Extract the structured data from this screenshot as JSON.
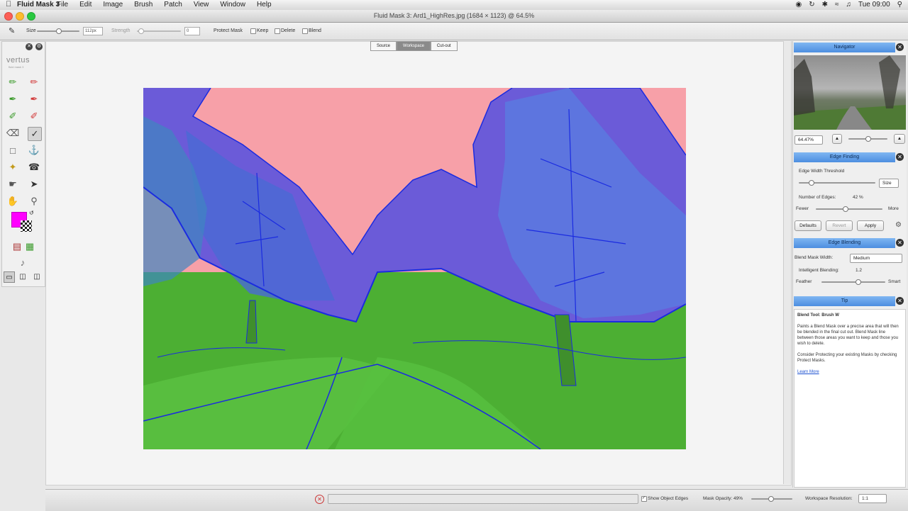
{
  "menubar": {
    "app_name": "Fluid Mask 3",
    "menus": [
      "File",
      "Edit",
      "Image",
      "Brush",
      "Patch",
      "View",
      "Window",
      "Help"
    ],
    "time": "Tue 09:00"
  },
  "window": {
    "title": "Fluid Mask 3: Ard1_HighRes.jpg (1684 × 1123) @ 64.5%"
  },
  "options": {
    "size_label": "Size",
    "size_value": "112px",
    "strength_label": "Strength",
    "strength_value": "0",
    "protect_mask_label": "Protect Mask",
    "keep_label": "Keep",
    "delete_label": "Delete",
    "blend_label": "Blend"
  },
  "leftbar": {
    "logo": "vertus",
    "logo_sub": "fluid mask 3"
  },
  "tabs": [
    "Source",
    "Workspace",
    "Cut-out"
  ],
  "active_tab": "Workspace",
  "navigator": {
    "title": "Navigator",
    "zoom_value": "64.47%"
  },
  "edge_finding": {
    "title": "Edge Finding",
    "threshold_label": "Edge Width Threshold",
    "threshold_value": "Size",
    "edges_label": "Number of Edges:",
    "edges_value": "42 %",
    "fewer_label": "Fewer",
    "more_label": "More",
    "defaults_button": "Defaults",
    "revert_button": "Revert",
    "apply_button": "Apply"
  },
  "edge_blending": {
    "title": "Edge Blending",
    "blend_width_label": "Blend Mask Width:",
    "blend_width_value": "Medium",
    "intelligent_label": "Intelligent Blending:",
    "intelligent_value": "1.2",
    "feather_label": "Feather",
    "smart_label": "Smart"
  },
  "tip": {
    "title": "Tip",
    "heading": "Blend Tool: Brush W",
    "line1": "Paints a Blend Mask over a precise area that will then be blended in the final cut out. Blend Mask line between those areas you want to keep and those you wish to delete.",
    "line2": "Consider Protecting your existing Masks by checking Protect Masks.",
    "learn_more": "Learn More"
  },
  "statusbar": {
    "show_edges_label": "Show Object Edges",
    "mask_opacity_label": "Mask Opacity: 49%",
    "resolution_label": "Workspace Resolution:",
    "resolution_value": "1:1"
  },
  "colors": {
    "accent": "#5a9be8",
    "keep": "#4caf33",
    "delete": "#f7a0a8",
    "blend": "#6b5bd8",
    "edge": "#1a2be0",
    "swatch": "#ff00ff"
  }
}
